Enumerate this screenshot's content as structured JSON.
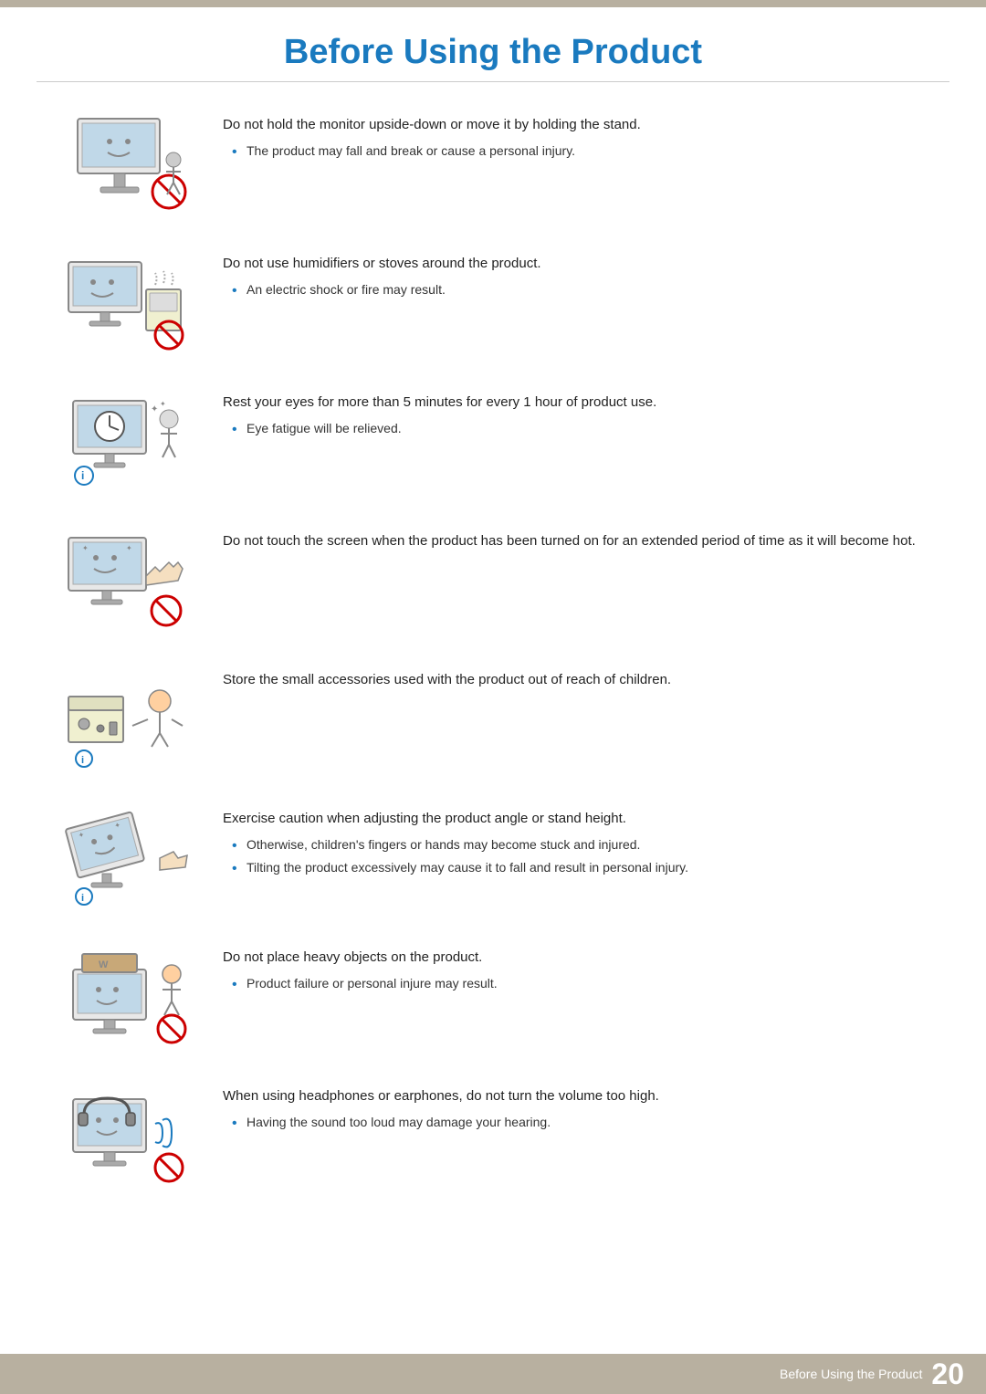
{
  "page": {
    "title": "Before Using the Product",
    "page_number": "20",
    "footer_label": "Before Using the Product"
  },
  "items": [
    {
      "id": "item-1",
      "main_text": "Do not hold the monitor upside-down or move it by holding the stand.",
      "bullets": [
        "The product may fall and break or cause a personal injury."
      ],
      "icon_type": "monitor-upside-down"
    },
    {
      "id": "item-2",
      "main_text": "Do not use humidifiers or stoves around the product.",
      "bullets": [
        "An electric shock or fire may result."
      ],
      "icon_type": "humidifier-stove"
    },
    {
      "id": "item-3",
      "main_text": "Rest your eyes for more than 5 minutes for every 1 hour of product use.",
      "bullets": [
        "Eye fatigue will be relieved."
      ],
      "icon_type": "eye-rest"
    },
    {
      "id": "item-4",
      "main_text": "Do not touch the screen when the product has been turned on for an extended period of time as it will become hot.",
      "bullets": [],
      "icon_type": "hot-screen"
    },
    {
      "id": "item-5",
      "main_text": "Store the small accessories used with the product out of reach of children.",
      "bullets": [],
      "icon_type": "accessories-children"
    },
    {
      "id": "item-6",
      "main_text": "Exercise caution when adjusting the product angle or stand height.",
      "bullets": [
        "Otherwise, children's fingers or hands may become stuck and injured.",
        "Tilting the product excessively may cause it to fall and result in personal injury."
      ],
      "icon_type": "angle-adjust"
    },
    {
      "id": "item-7",
      "main_text": "Do not place heavy objects on the product.",
      "bullets": [
        "Product failure or personal injure may result."
      ],
      "icon_type": "heavy-objects"
    },
    {
      "id": "item-8",
      "main_text": "When using headphones or earphones, do not turn the volume too high.",
      "bullets": [
        "Having the sound too loud may damage your hearing."
      ],
      "icon_type": "headphones"
    }
  ]
}
